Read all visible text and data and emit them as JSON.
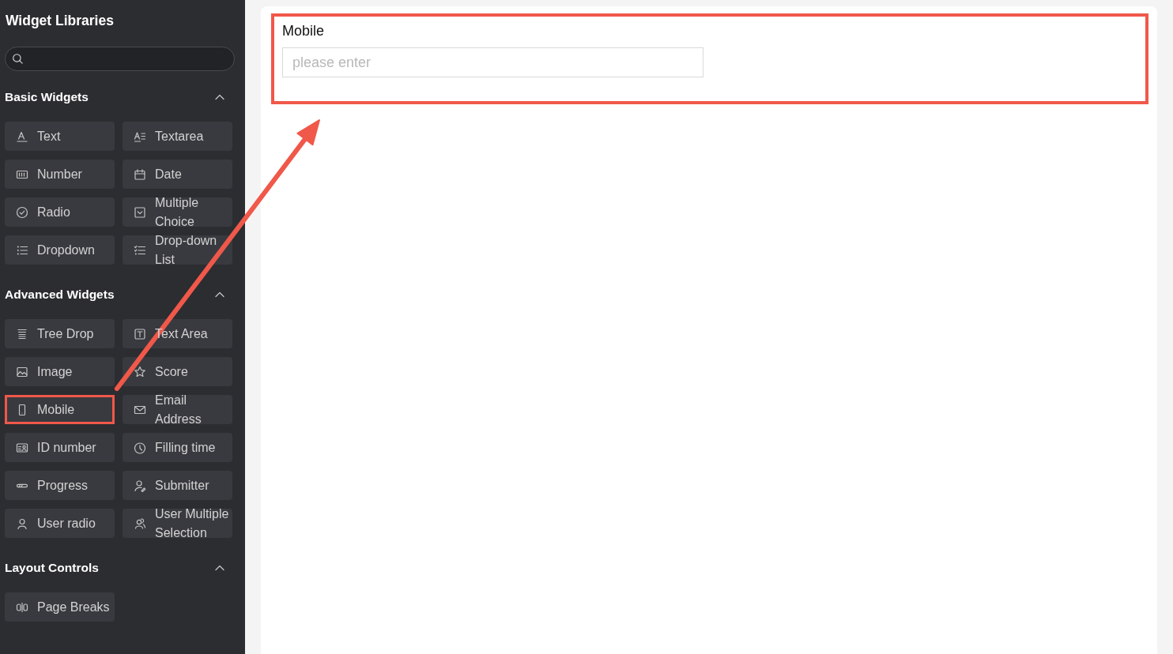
{
  "sidebar": {
    "title": "Widget Libraries",
    "sections": [
      {
        "title": "Basic Widgets",
        "expanded": true,
        "items": [
          {
            "label": "Text",
            "highlighted": false
          },
          {
            "label": "Number",
            "highlighted": false
          },
          {
            "label": "Radio",
            "highlighted": false
          },
          {
            "label": "Dropdown",
            "highlighted": false
          },
          {
            "label": "Textarea",
            "highlighted": false
          },
          {
            "label": "Date",
            "highlighted": false
          },
          {
            "label": "Multiple Choice",
            "highlighted": false
          },
          {
            "label": "Drop-down List",
            "highlighted": false
          }
        ]
      },
      {
        "title": "Advanced Widgets",
        "expanded": true,
        "items": [
          {
            "label": "Tree Drop",
            "highlighted": false
          },
          {
            "label": "Image",
            "highlighted": false
          },
          {
            "label": "Mobile",
            "highlighted": true
          },
          {
            "label": "ID number",
            "highlighted": false
          },
          {
            "label": "Progress",
            "highlighted": false
          },
          {
            "label": "User radio",
            "highlighted": false
          },
          {
            "label": "Text Area",
            "highlighted": false
          },
          {
            "label": "Score",
            "highlighted": false
          },
          {
            "label": "Email Address",
            "highlighted": false
          },
          {
            "label": "Filling time",
            "highlighted": false
          },
          {
            "label": "Submitter",
            "highlighted": false
          },
          {
            "label": "User Multiple Selection",
            "highlighted": false
          }
        ]
      },
      {
        "title": "Layout Controls",
        "expanded": true,
        "items": [
          {
            "label": "Page Breaks",
            "highlighted": false
          }
        ]
      }
    ]
  },
  "form": {
    "fields": [
      {
        "label": "Mobile",
        "placeholder": "please enter",
        "highlighted": true
      }
    ]
  }
}
